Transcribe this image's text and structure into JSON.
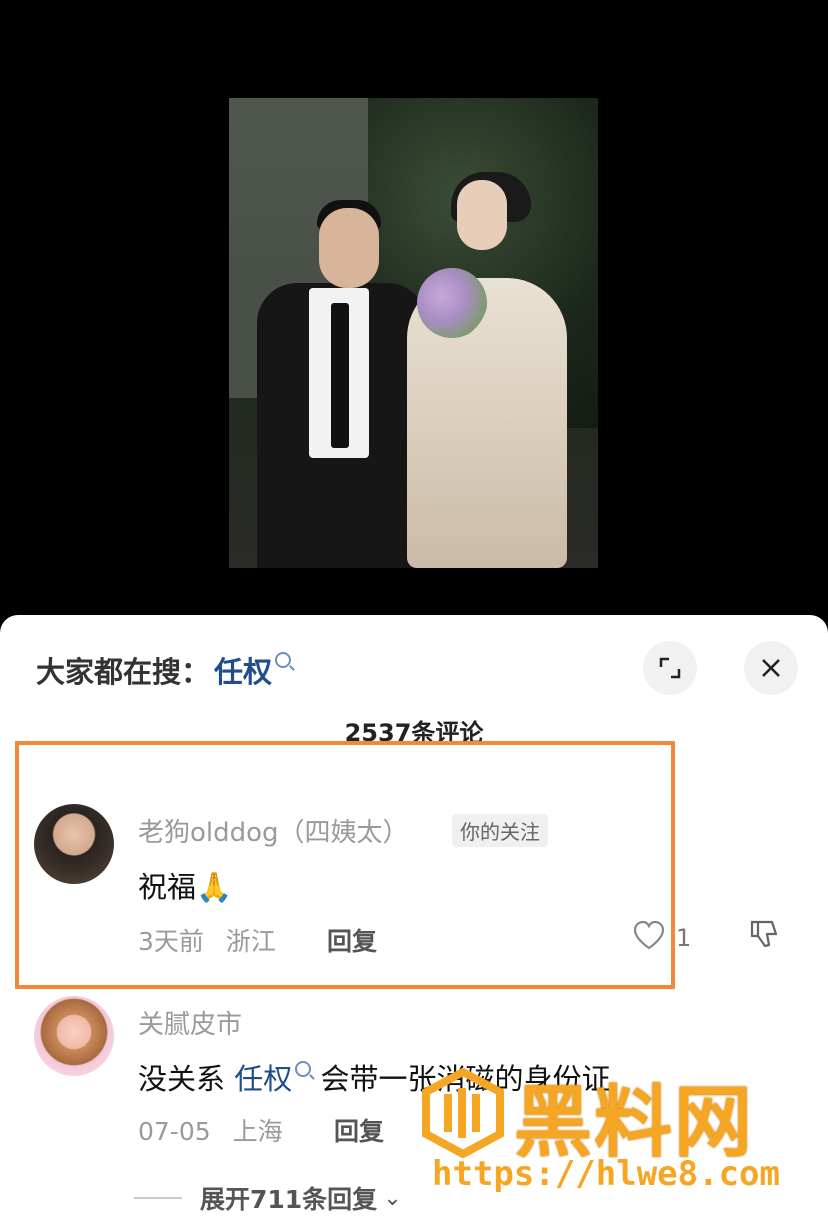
{
  "header": {
    "hot_search_label": "大家都在搜：",
    "hot_search_keyword": "任权"
  },
  "comments_count": "2537条评论",
  "comments": [
    {
      "user": "老狗olddog（四姨太）",
      "tag": "你的关注",
      "text": "祝福🙏",
      "time": "3天前",
      "location": "浙江",
      "reply_label": "回复",
      "likes": "1"
    },
    {
      "user": "关腻皮市",
      "text_prefix": "没关系",
      "keyword": "任权",
      "text_suffix": "会带一张消磁的身份证",
      "time": "07-05",
      "location": "上海",
      "reply_label": "回复"
    }
  ],
  "expand_replies": "展开711条回复",
  "watermark": {
    "title": "黑料网",
    "url": "https://hlwe8.com"
  },
  "colors": {
    "highlight_border": "#f08a3a",
    "keyword": "#1f4e8c",
    "watermark": "#f5a623"
  }
}
